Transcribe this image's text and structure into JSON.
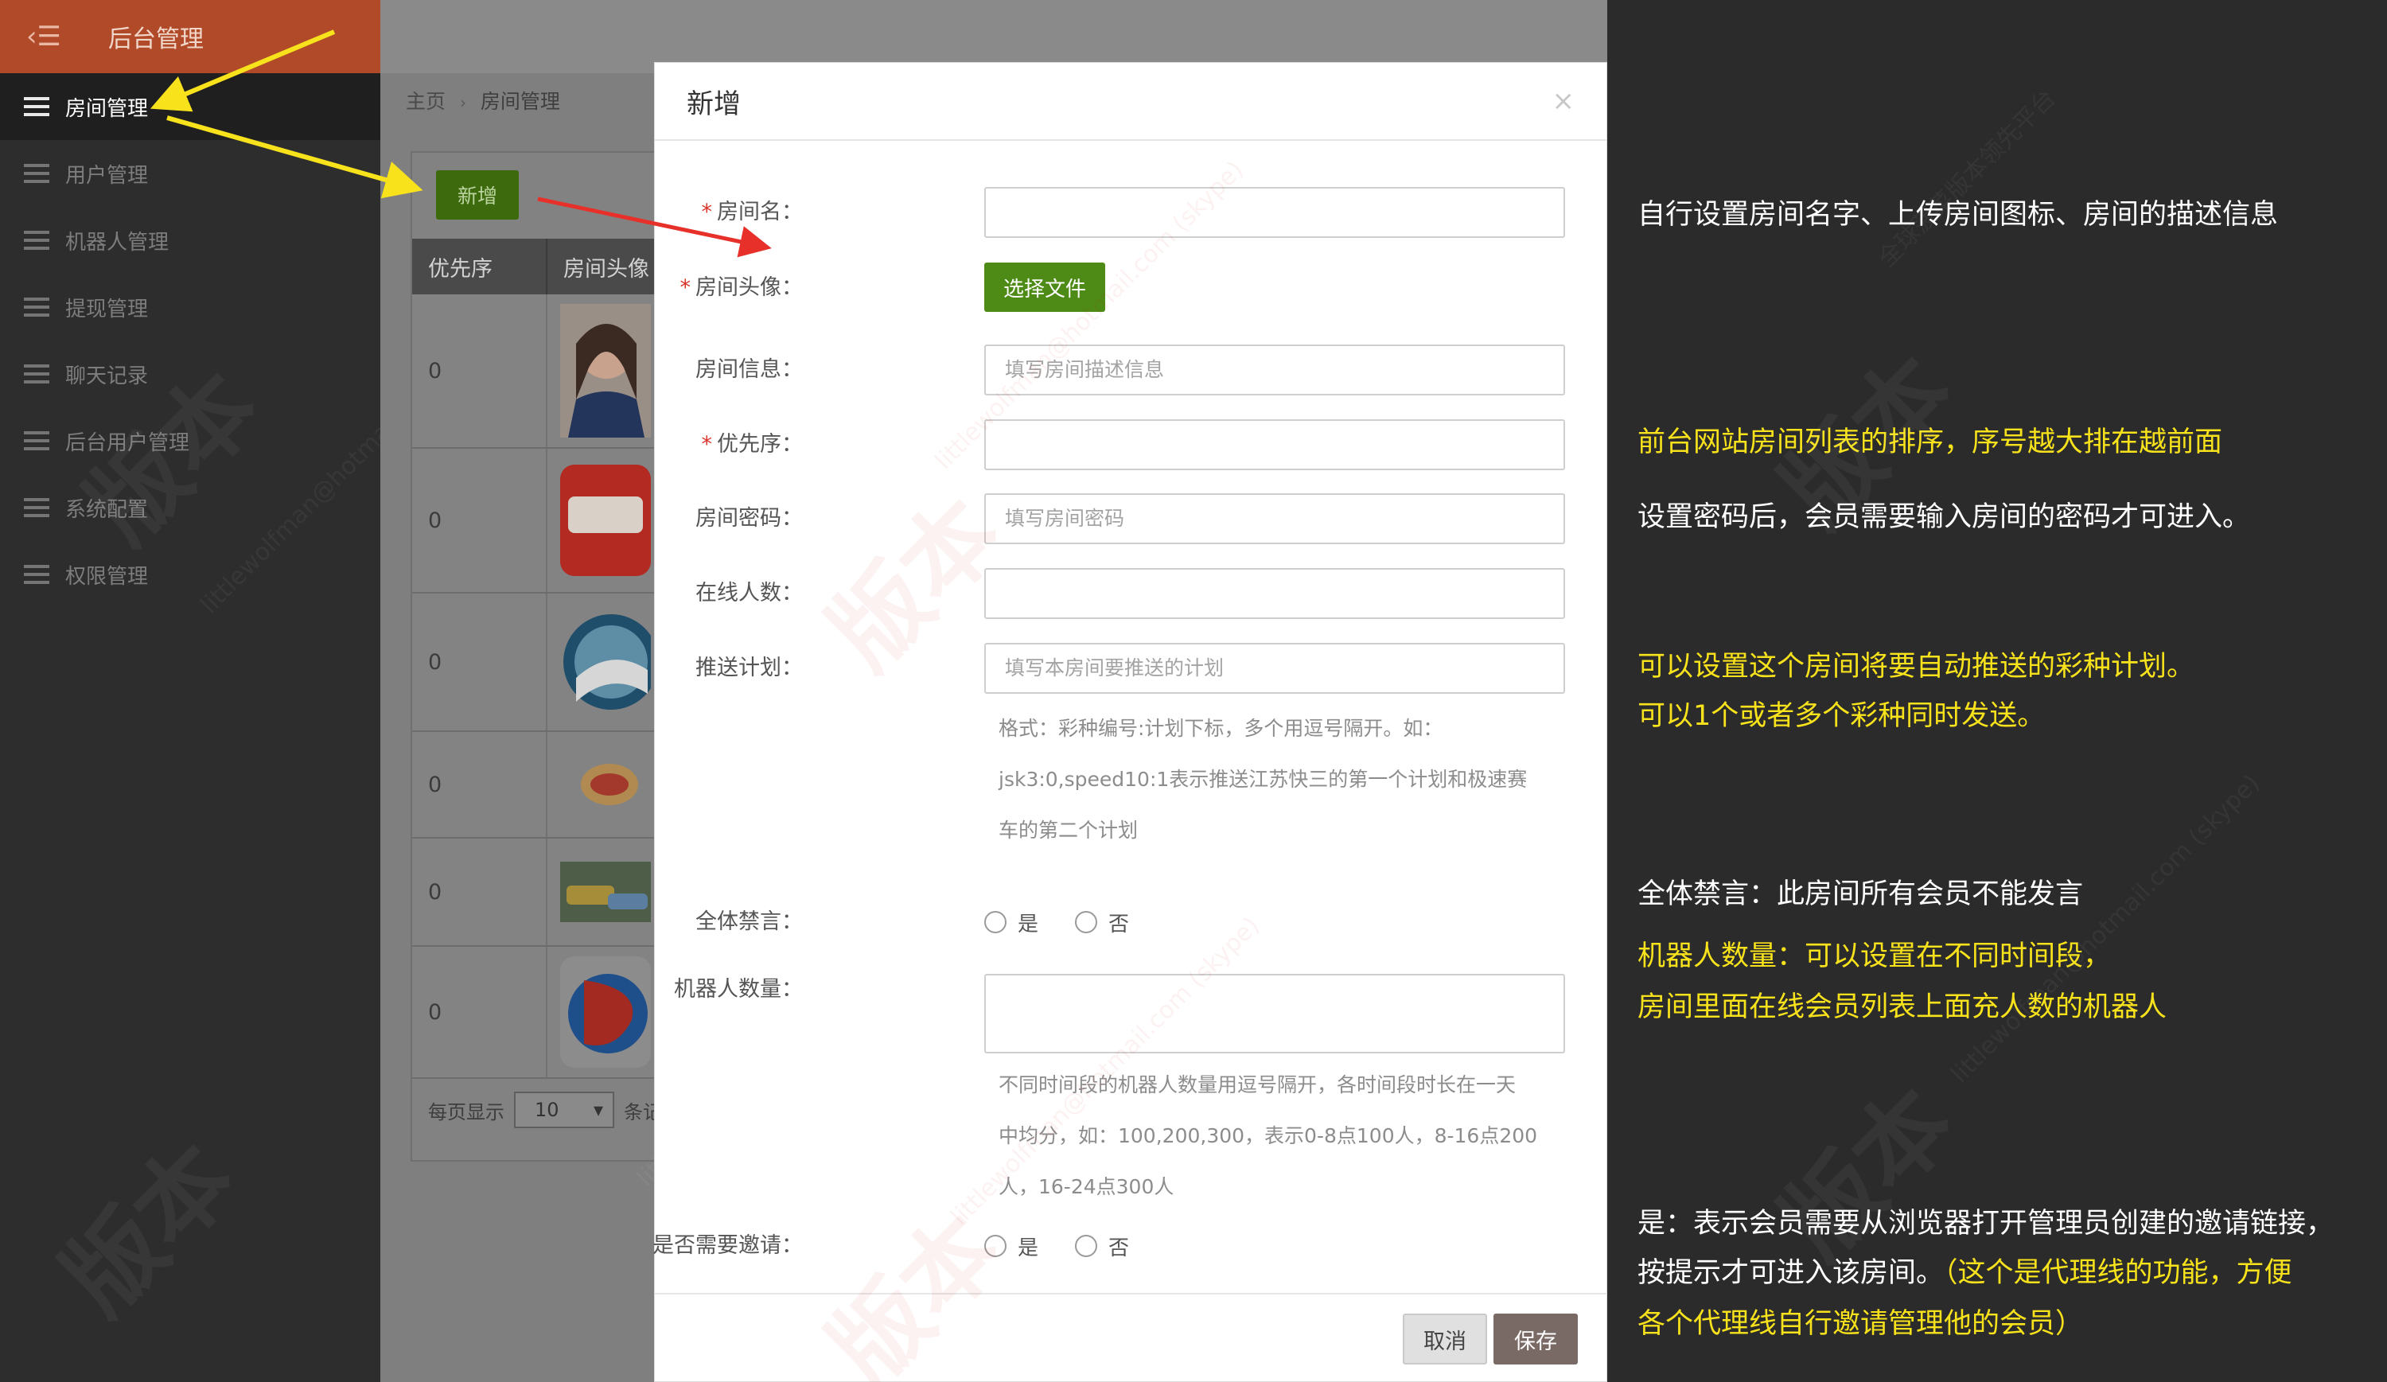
{
  "sidebar": {
    "title": "后台管理",
    "toggle_icon": "‹☰",
    "items": [
      {
        "label": "房间管理",
        "active": true
      },
      {
        "label": "用户管理"
      },
      {
        "label": "机器人管理"
      },
      {
        "label": "提现管理"
      },
      {
        "label": "聊天记录"
      },
      {
        "label": "后台用户管理"
      },
      {
        "label": "系统配置"
      },
      {
        "label": "权限管理"
      }
    ]
  },
  "main": {
    "breadcrumb": {
      "home": "主页",
      "current": "房间管理"
    },
    "add_button": "新增",
    "table": {
      "headers": [
        "优先序",
        "房间头像"
      ],
      "rows": [
        {
          "priority": "0"
        },
        {
          "priority": "0"
        },
        {
          "priority": "0"
        },
        {
          "priority": "0"
        },
        {
          "priority": "0"
        },
        {
          "priority": "0"
        }
      ]
    },
    "pager": {
      "per_page_label": "每页显示",
      "per_page_value": "10",
      "suffix": "条记"
    }
  },
  "modal": {
    "title": "新增",
    "close": "×",
    "fields": {
      "room_name": {
        "label": "房间名：",
        "required": true,
        "value": ""
      },
      "avatar": {
        "label": "房间头像：",
        "required": true,
        "button": "选择文件"
      },
      "info": {
        "label": "房间信息：",
        "placeholder": "填写房间描述信息"
      },
      "priority": {
        "label": "优先序：",
        "required": true,
        "value": ""
      },
      "password": {
        "label": "房间密码：",
        "placeholder": "填写房间密码"
      },
      "online": {
        "label": "在线人数：",
        "value": ""
      },
      "push_plan": {
        "label": "推送计划：",
        "placeholder": "填写本房间要推送的计划",
        "help": [
          "格式：彩种编号:计划下标，多个用逗号隔开。如：",
          "jsk3:0,speed10:1表示推送江苏快三的第一个计划和极速赛",
          "车的第二个计划"
        ]
      },
      "mute_all": {
        "label": "全体禁言：",
        "yes": "是",
        "no": "否"
      },
      "robots": {
        "label": "机器人数量：",
        "help": [
          "不同时间段的机器人数量用逗号隔开，各时间段时长在一天",
          "中均分，如：100,200,300，表示0-8点100人，8-16点200",
          "人，16-24点300人"
        ]
      },
      "invite": {
        "label": "是否需要邀请：",
        "yes": "是",
        "no": "否"
      }
    },
    "cancel": "取消",
    "save": "保存"
  },
  "annotations": {
    "n1": "自行设置房间名字、上传房间图标、房间的描述信息",
    "n2": "前台网站房间列表的排序，序号越大排在越前面",
    "n3": "设置密码后，会员需要输入房间的密码才可进入。",
    "n4a": "可以设置这个房间将要自动推送的彩种计划。",
    "n4b": "可以1个或者多个彩种同时发送。",
    "n5": "全体禁言：此房间所有会员不能发言",
    "n6a": "机器人数量：可以设置在不同时间段，",
    "n6b": "房间里面在线会员列表上面充人数的机器人",
    "n7a": "是：表示会员需要从浏览器打开管理员创建的邀请链接，",
    "n7b": "按提示才可进入该房间。",
    "n7b_yellow": "（这个是代理线的功能，方便",
    "n7c": "各个代理线自行邀请管理他的会员）"
  },
  "watermark": {
    "text": "全球菠菜版本领先平台",
    "email": "littlewolfman@hotmail.com (skype)",
    "big": "版本"
  },
  "colors": {
    "accent": "#b04a28",
    "primary_green": "#4d8b16",
    "annotation_yellow": "#f7e21c",
    "required_red": "#d9342b",
    "arrow_yellow": "#f7e21c",
    "arrow_red": "#e8302a"
  }
}
